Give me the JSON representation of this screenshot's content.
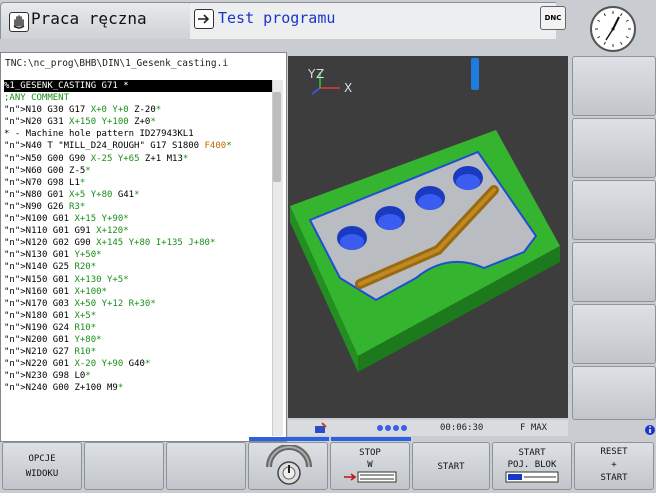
{
  "header": {
    "mode_label": "Praca ręczna",
    "sub_mode_label": "Test programu",
    "dnc_label": "DNC"
  },
  "program": {
    "path": "TNC:\\nc_prog\\BHB\\DIN\\1_Gesenk_casting.i",
    "lines": [
      {
        "n": "%1_GESENK_CASTING G71 *",
        "cls": "sel"
      },
      {
        "n": ";ANY COMMENT",
        "cls": "c"
      },
      {
        "n": "N10 G30 G17 X+0 Y+0 Z-20*",
        "cls": ""
      },
      {
        "n": "N20 G31 X+150 Y+100 Z+0*",
        "cls": ""
      },
      {
        "n": "* - Machine hole pattern ID27943KL1",
        "cls": ""
      },
      {
        "n": "N40 T \"MILL_D24_ROUGH\" G17 S1800 F400*",
        "cls": ""
      },
      {
        "n": "N50 G00 G90 X-25 Y+65 Z+1 M13*",
        "cls": ""
      },
      {
        "n": "N60 G00 Z-5*",
        "cls": ""
      },
      {
        "n": "N70 G98 L1*",
        "cls": ""
      },
      {
        "n": "N80 G01 X+5 Y+80 G41*",
        "cls": ""
      },
      {
        "n": "N90 G26 R3*",
        "cls": ""
      },
      {
        "n": "N100 G01 X+15 Y+90*",
        "cls": ""
      },
      {
        "n": "N110 G01 G91 X+120*",
        "cls": ""
      },
      {
        "n": "N120 G02 G90 X+145 Y+80 I+135 J+80*",
        "cls": ""
      },
      {
        "n": "N130 G01 Y+50*",
        "cls": ""
      },
      {
        "n": "N140 G25 R20*",
        "cls": ""
      },
      {
        "n": "N150 G01 X+130 Y+5*",
        "cls": ""
      },
      {
        "n": "N160 G01 X+100*",
        "cls": ""
      },
      {
        "n": "N170 G03 X+50 Y+12 R+30*",
        "cls": ""
      },
      {
        "n": "N180 G01 X+5*",
        "cls": ""
      },
      {
        "n": "N190 G24 R10*",
        "cls": ""
      },
      {
        "n": "N200 G01 Y+80*",
        "cls": ""
      },
      {
        "n": "N210 G27 R10*",
        "cls": ""
      },
      {
        "n": "N220 G01 X-20 Y+90 G40*",
        "cls": ""
      },
      {
        "n": "N230 G98 L0*",
        "cls": ""
      },
      {
        "n": "N240 G00 Z+100 M9*",
        "cls": ""
      }
    ]
  },
  "graphic": {
    "axis_x": "X",
    "axis_y": "Y",
    "axis_z": "Z"
  },
  "status": {
    "time": "00:06:30",
    "feed": "F MAX"
  },
  "softkeys": {
    "opcje_l1": "OPCJE",
    "opcje_l2": "WIDOKU",
    "stop_l1": "STOP",
    "stop_l2": "W",
    "start": "START",
    "start_blok_l1": "START",
    "start_blok_l2": "POJ. BLOK",
    "reset_l1": "RESET",
    "reset_l2": "+",
    "reset_l3": "START"
  },
  "colors": {
    "accent_blue": "#1a36c9",
    "block_number": "#9a147a",
    "comment": "#1a8f1a",
    "feed": "#c46a00",
    "string": "#c41414",
    "workpiece_green": "#35b52f",
    "workpiece_gray": "#b9bcc0",
    "slot_brown": "#9a6a12"
  }
}
